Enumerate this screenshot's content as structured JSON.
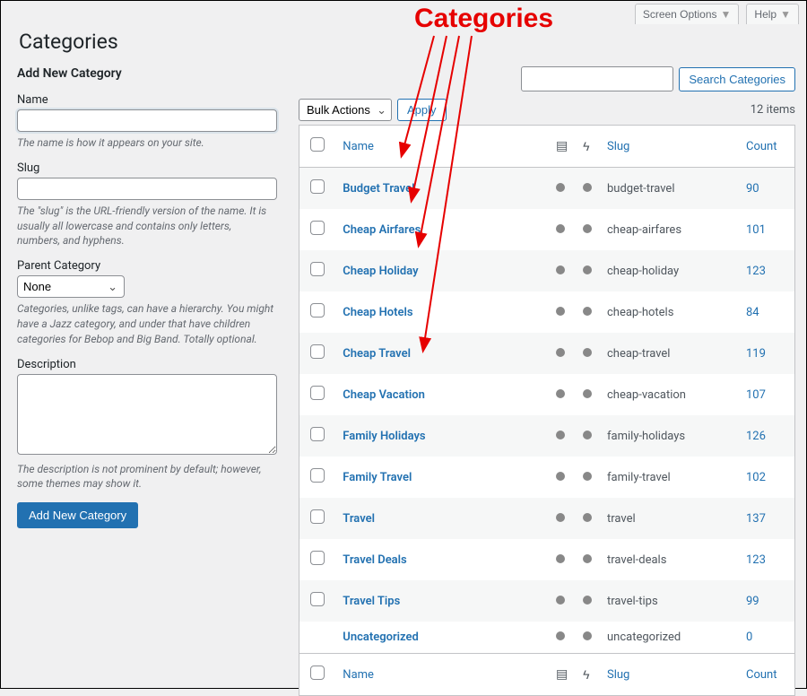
{
  "screen_options_label": "Screen Options",
  "help_label": "Help",
  "page_title": "Categories",
  "left": {
    "heading": "Add New Category",
    "name_label": "Name",
    "name_hint": "The name is how it appears on your site.",
    "slug_label": "Slug",
    "slug_hint": "The \"slug\" is the URL-friendly version of the name. It is usually all lowercase and contains only letters, numbers, and hyphens.",
    "parent_label": "Parent Category",
    "parent_value": "None",
    "parent_hint": "Categories, unlike tags, can have a hierarchy. You might have a Jazz category, and under that have children categories for Bebop and Big Band. Totally optional.",
    "desc_label": "Description",
    "desc_hint": "The description is not prominent by default; however, some themes may show it.",
    "submit_label": "Add New Category"
  },
  "search": {
    "button": "Search Categories"
  },
  "bulk": {
    "label": "Bulk Actions",
    "apply": "Apply"
  },
  "items_text": "12 items",
  "cols": {
    "name": "Name",
    "slug": "Slug",
    "count": "Count"
  },
  "rows": [
    {
      "name": "Budget Travel",
      "slug": "budget-travel",
      "count": "90",
      "cb": true
    },
    {
      "name": "Cheap Airfares",
      "slug": "cheap-airfares",
      "count": "101",
      "cb": true
    },
    {
      "name": "Cheap Holiday",
      "slug": "cheap-holiday",
      "count": "123",
      "cb": true
    },
    {
      "name": "Cheap Hotels",
      "slug": "cheap-hotels",
      "count": "84",
      "cb": true
    },
    {
      "name": "Cheap Travel",
      "slug": "cheap-travel",
      "count": "119",
      "cb": true
    },
    {
      "name": "Cheap Vacation",
      "slug": "cheap-vacation",
      "count": "107",
      "cb": true
    },
    {
      "name": "Family Holidays",
      "slug": "family-holidays",
      "count": "126",
      "cb": true
    },
    {
      "name": "Family Travel",
      "slug": "family-travel",
      "count": "102",
      "cb": true
    },
    {
      "name": "Travel",
      "slug": "travel",
      "count": "137",
      "cb": true
    },
    {
      "name": "Travel Deals",
      "slug": "travel-deals",
      "count": "123",
      "cb": true
    },
    {
      "name": "Travel Tips",
      "slug": "travel-tips",
      "count": "99",
      "cb": true
    },
    {
      "name": "Uncategorized",
      "slug": "uncategorized",
      "count": "0",
      "cb": false
    }
  ],
  "annotation_label": "Categories"
}
